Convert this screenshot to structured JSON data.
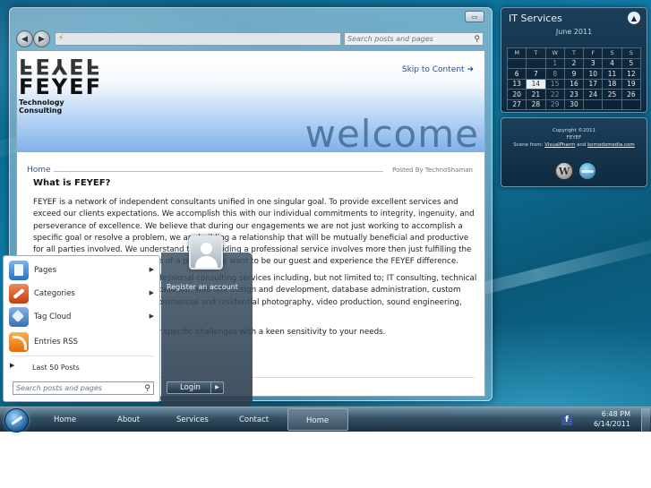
{
  "browser": {
    "address_text": "⚡",
    "search_placeholder": "Search posts and pages",
    "close_label": "▭"
  },
  "site": {
    "logo_top": "FEYEF",
    "logo_main": "FEYEF",
    "logo_sub": "Technology Consulting",
    "skip_link": "Skip to Content",
    "banner_word": "welcome",
    "breadcrumb": "Home",
    "posted_by": "Posted By TechnoShaman",
    "post_title": "What is FEYEF?",
    "paragraphs": [
      "FEYEF is a network of independent consultants unified in one singular goal. To provide excellent services and exceed our clients expectations. We accomplish this with our individual commitments to integrity, ingenuity, and perseverance of excellence. We believe that during our engagements we are not just working to accomplish a specific goal or resolve a problem, we are building a relationship that will be mutually beneficial and productive for all parties involved. We understand that providing a professional service involves more then just fulfilling the desired and agreed requirements of a project. We want to be our guest and experience the FEYEF difference.",
      "FEYEF offers a wide range of professional consulting services including, but not limited to; IT consulting, technical support, network design and installation, web site design and development, database administration, custom programming, graphic design, commercial and residential photography, video production, sound engineering, and voice consulting.",
      "We look forward to meeting your specific challenges with a keen sensitivity to your needs."
    ]
  },
  "calendar": {
    "title": "IT Services",
    "month": "June 2011",
    "headers": [
      "M",
      "T",
      "W",
      "T",
      "F",
      "S",
      "S"
    ],
    "rows": [
      [
        "",
        "",
        "1",
        "2",
        "3",
        "4",
        "5"
      ],
      [
        "6",
        "7",
        "8",
        "9",
        "10",
        "11",
        "12"
      ],
      [
        "13",
        "14",
        "15",
        "16",
        "17",
        "18",
        "19"
      ],
      [
        "20",
        "21",
        "22",
        "23",
        "24",
        "25",
        "26"
      ],
      [
        "27",
        "28",
        "29",
        "30",
        "",
        "",
        ""
      ]
    ],
    "today": "14"
  },
  "copyright": {
    "line1": "Copyright ©2011",
    "line2": "FEYEF",
    "line3_prefix": "Scene from:",
    "line3_link1": "VisualPharm",
    "line3_and": "and",
    "line3_link2": "komodomedia.com"
  },
  "start_menu": {
    "items": [
      {
        "label": "Pages",
        "has_arrow": true
      },
      {
        "label": "Categories",
        "has_arrow": true
      },
      {
        "label": "Tag Cloud",
        "has_arrow": true
      },
      {
        "label": "Entries RSS",
        "has_arrow": false
      }
    ],
    "last50": "Last 50 Posts",
    "search_placeholder": "Search posts and pages",
    "register": "Register an account",
    "login": "Login"
  },
  "taskbar": {
    "links": [
      "Home",
      "About",
      "Services",
      "Contact"
    ],
    "active": "Home",
    "time": "6:48 PM",
    "date": "6/14/2011"
  }
}
